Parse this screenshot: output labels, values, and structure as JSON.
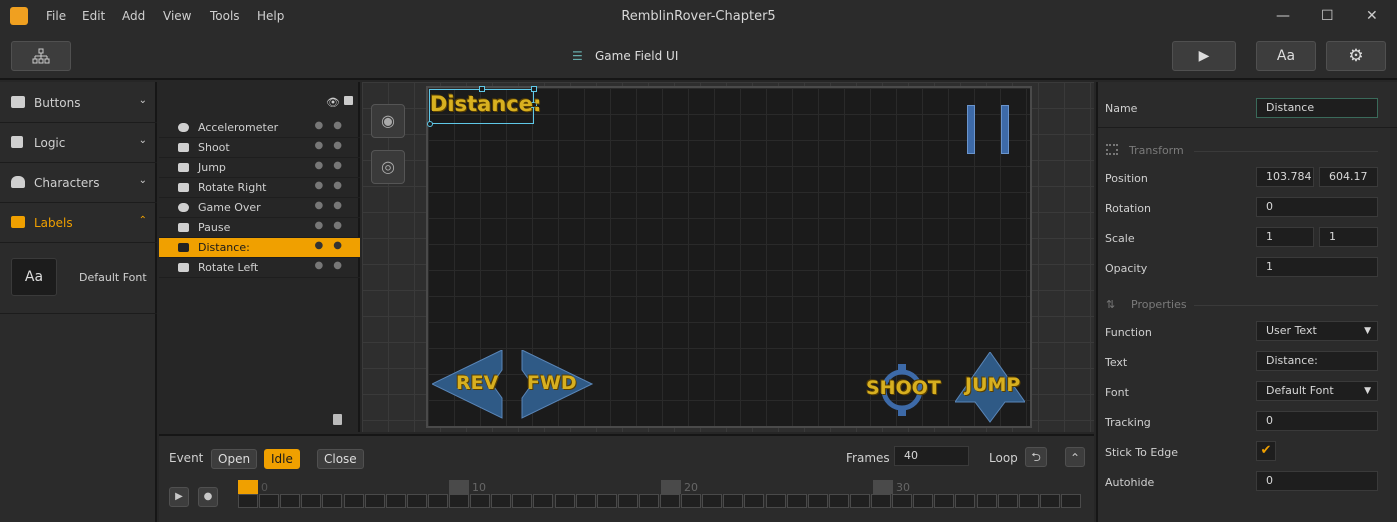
{
  "menu": {
    "items": [
      "File",
      "Edit",
      "Add",
      "View",
      "Tools",
      "Help"
    ]
  },
  "window": {
    "title": "RemblinRover-Chapter5",
    "minimize": "—",
    "maximize": "☐",
    "close": "✕"
  },
  "toolbar": {
    "scene_title": "Game Field UI",
    "play_icon": "▶",
    "font_label": "Aa",
    "settings_icon": "⚙"
  },
  "categories": [
    {
      "label": "Buttons"
    },
    {
      "label": "Logic"
    },
    {
      "label": "Characters"
    },
    {
      "label": "Labels"
    }
  ],
  "assets": {
    "default_font_label": "Default Font",
    "thumb": "Aa"
  },
  "layers": [
    {
      "label": "Accelerometer"
    },
    {
      "label": "Shoot"
    },
    {
      "label": "Jump"
    },
    {
      "label": "Rotate Right"
    },
    {
      "label": "Game Over"
    },
    {
      "label": "Pause"
    },
    {
      "label": "Distance:"
    },
    {
      "label": "Rotate Left"
    }
  ],
  "canvas": {
    "distance_text": "Distance:",
    "rev": "REV",
    "fwd": "FWD",
    "shoot": "SHOOT",
    "jump": "JUMP"
  },
  "inspector": {
    "name_label": "Name",
    "name_value": "Distance",
    "transform_heading": "Transform",
    "position_label": "Position",
    "position_x": "103.784",
    "position_y": "604.17",
    "rotation_label": "Rotation",
    "rotation_value": "0",
    "scale_label": "Scale",
    "scale_x": "1",
    "scale_y": "1",
    "opacity_label": "Opacity",
    "opacity_value": "1",
    "properties_heading": "Properties",
    "function_label": "Function",
    "function_value": "User Text",
    "text_label": "Text",
    "text_value": "Distance:",
    "font_label": "Font",
    "font_value": "Default Font",
    "tracking_label": "Tracking",
    "tracking_value": "0",
    "stick_label": "Stick To Edge",
    "stick_checked": true,
    "autohide_label": "Autohide",
    "autohide_value": "0"
  },
  "timeline": {
    "event_label": "Event",
    "open": "Open",
    "idle": "Idle",
    "close": "Close",
    "frames_label": "Frames",
    "frames_value": "40",
    "loop_label": "Loop",
    "loop_icon": "⮌",
    "collapse_icon": "⌃",
    "markers": [
      "0",
      "10",
      "20",
      "30"
    ]
  },
  "colors": {
    "accent": "#f0a000",
    "selection": "#5fc8e8"
  }
}
